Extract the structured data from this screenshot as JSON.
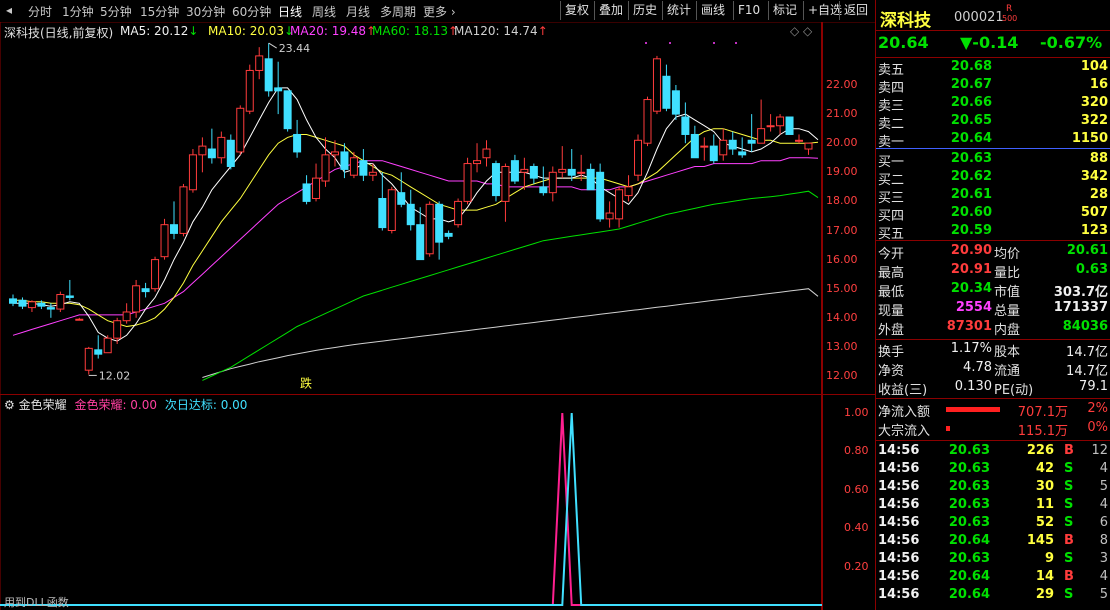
{
  "toolbar": {
    "periods": [
      "分时",
      "1分钟",
      "5分钟",
      "15分钟",
      "30分钟",
      "60分钟",
      "日线",
      "周线",
      "月线",
      "多周期",
      "更多"
    ],
    "active_period": "日线",
    "right_buttons": [
      "复权",
      "叠加",
      "历史",
      "统计",
      "画线",
      "F10",
      "标记",
      "+自选",
      "返回"
    ]
  },
  "chart_header": {
    "title": "深科技(日线,前复权)",
    "ma5": "MA5: 20.12",
    "ma10": "MA10: 20.03",
    "ma20": "MA20: 19.48",
    "ma60": "MA60: 18.13",
    "ma120": "MA120: 14.74",
    "arrows": [
      "↓",
      "↓",
      "↑",
      "↑",
      "↑"
    ]
  },
  "price_axis": [
    "22.00",
    "21.00",
    "20.00",
    "19.00",
    "18.00",
    "17.00",
    "16.00",
    "15.00",
    "14.00",
    "13.00",
    "12.00"
  ],
  "annotations": {
    "high_label": "23.44",
    "low_label": "12.02",
    "marker": "跌"
  },
  "indicator": {
    "name": "金色荣耀",
    "line1": "金色荣耀: 0.00",
    "line2": "次日达标: 0.00",
    "axis": [
      "1.00",
      "0.80",
      "0.60",
      "0.40",
      "0.20"
    ],
    "footer": "用到DLL函数"
  },
  "colors": {
    "up": "#ff3c3c",
    "down": "#40e0ff",
    "ma5": "#ffffff",
    "ma10": "#ffff40",
    "ma20": "#ff40ff",
    "ma60": "#00e000",
    "ma120": "#d0d0d0"
  },
  "chart_data": {
    "type": "candlestick",
    "candles": [
      {
        "o": 14.65,
        "h": 14.8,
        "l": 14.4,
        "c": 14.5
      },
      {
        "o": 14.6,
        "h": 14.7,
        "l": 14.3,
        "c": 14.4
      },
      {
        "o": 14.35,
        "h": 14.6,
        "l": 14.2,
        "c": 14.55
      },
      {
        "o": 14.5,
        "h": 14.6,
        "l": 14.3,
        "c": 14.4
      },
      {
        "o": 14.35,
        "h": 14.5,
        "l": 14.0,
        "c": 14.3
      },
      {
        "o": 14.3,
        "h": 14.9,
        "l": 14.2,
        "c": 14.8
      },
      {
        "o": 14.75,
        "h": 15.3,
        "l": 14.6,
        "c": 14.7
      },
      {
        "o": 13.95,
        "h": 14.0,
        "l": 13.95,
        "c": 13.95
      },
      {
        "o": 12.2,
        "h": 13.0,
        "l": 12.05,
        "c": 12.95
      },
      {
        "o": 12.9,
        "h": 13.4,
        "l": 12.6,
        "c": 12.75
      },
      {
        "o": 12.8,
        "h": 13.4,
        "l": 12.8,
        "c": 13.3
      },
      {
        "o": 13.3,
        "h": 14.0,
        "l": 13.1,
        "c": 13.9
      },
      {
        "o": 13.9,
        "h": 14.5,
        "l": 13.8,
        "c": 14.2
      },
      {
        "o": 14.2,
        "h": 15.3,
        "l": 14.0,
        "c": 15.1
      },
      {
        "o": 15.0,
        "h": 15.2,
        "l": 14.7,
        "c": 14.9
      },
      {
        "o": 15.0,
        "h": 16.1,
        "l": 14.9,
        "c": 16.0
      },
      {
        "o": 16.1,
        "h": 17.4,
        "l": 16.0,
        "c": 17.2
      },
      {
        "o": 17.2,
        "h": 18.0,
        "l": 16.7,
        "c": 16.9
      },
      {
        "o": 16.9,
        "h": 18.6,
        "l": 16.8,
        "c": 18.5
      },
      {
        "o": 18.4,
        "h": 19.8,
        "l": 18.3,
        "c": 19.6
      },
      {
        "o": 19.6,
        "h": 20.2,
        "l": 19.0,
        "c": 19.9
      },
      {
        "o": 19.8,
        "h": 20.5,
        "l": 19.3,
        "c": 19.5
      },
      {
        "o": 19.5,
        "h": 20.4,
        "l": 19.3,
        "c": 20.2
      },
      {
        "o": 20.1,
        "h": 20.3,
        "l": 19.1,
        "c": 19.2
      },
      {
        "o": 19.7,
        "h": 21.3,
        "l": 19.6,
        "c": 21.2
      },
      {
        "o": 21.1,
        "h": 22.7,
        "l": 21.0,
        "c": 22.5
      },
      {
        "o": 22.5,
        "h": 23.3,
        "l": 22.2,
        "c": 23.0
      },
      {
        "o": 22.9,
        "h": 23.44,
        "l": 21.6,
        "c": 21.8
      },
      {
        "o": 21.9,
        "h": 22.8,
        "l": 21.0,
        "c": 21.8
      },
      {
        "o": 21.8,
        "h": 21.8,
        "l": 20.4,
        "c": 20.5
      },
      {
        "o": 20.3,
        "h": 20.8,
        "l": 19.5,
        "c": 19.7
      },
      {
        "o": 18.6,
        "h": 18.9,
        "l": 17.9,
        "c": 18.0
      },
      {
        "o": 18.1,
        "h": 19.3,
        "l": 18.0,
        "c": 18.8
      },
      {
        "o": 18.7,
        "h": 20.2,
        "l": 18.5,
        "c": 19.6
      },
      {
        "o": 19.6,
        "h": 20.1,
        "l": 19.2,
        "c": 19.7
      },
      {
        "o": 19.7,
        "h": 20.0,
        "l": 18.8,
        "c": 19.1
      },
      {
        "o": 18.9,
        "h": 19.7,
        "l": 18.8,
        "c": 19.5
      },
      {
        "o": 19.4,
        "h": 19.8,
        "l": 18.7,
        "c": 18.9
      },
      {
        "o": 18.9,
        "h": 19.3,
        "l": 18.7,
        "c": 19.0
      },
      {
        "o": 18.1,
        "h": 19.0,
        "l": 17.0,
        "c": 17.1
      },
      {
        "o": 17.0,
        "h": 18.5,
        "l": 16.9,
        "c": 18.4
      },
      {
        "o": 18.3,
        "h": 19.0,
        "l": 17.8,
        "c": 17.9
      },
      {
        "o": 17.9,
        "h": 18.4,
        "l": 17.0,
        "c": 17.2
      },
      {
        "o": 17.2,
        "h": 17.8,
        "l": 16.0,
        "c": 16.0
      },
      {
        "o": 16.2,
        "h": 18.0,
        "l": 16.1,
        "c": 17.9
      },
      {
        "o": 17.9,
        "h": 18.0,
        "l": 16.0,
        "c": 16.6
      },
      {
        "o": 16.9,
        "h": 17.0,
        "l": 16.7,
        "c": 16.8
      },
      {
        "o": 17.2,
        "h": 18.1,
        "l": 17.1,
        "c": 18.0
      },
      {
        "o": 18.0,
        "h": 19.5,
        "l": 17.9,
        "c": 19.3
      },
      {
        "o": 19.3,
        "h": 20.0,
        "l": 19.0,
        "c": 19.4
      },
      {
        "o": 19.5,
        "h": 20.1,
        "l": 19.2,
        "c": 19.8
      },
      {
        "o": 19.3,
        "h": 19.4,
        "l": 18.0,
        "c": 18.2
      },
      {
        "o": 18.0,
        "h": 19.3,
        "l": 17.3,
        "c": 19.2
      },
      {
        "o": 19.4,
        "h": 19.6,
        "l": 18.6,
        "c": 18.7
      },
      {
        "o": 19.0,
        "h": 19.5,
        "l": 18.4,
        "c": 19.1
      },
      {
        "o": 19.2,
        "h": 19.3,
        "l": 18.6,
        "c": 18.8
      },
      {
        "o": 18.5,
        "h": 19.2,
        "l": 18.2,
        "c": 18.3
      },
      {
        "o": 18.3,
        "h": 19.2,
        "l": 18.0,
        "c": 19.0
      },
      {
        "o": 19.0,
        "h": 19.9,
        "l": 18.8,
        "c": 19.1
      },
      {
        "o": 19.1,
        "h": 19.8,
        "l": 18.7,
        "c": 18.9
      },
      {
        "o": 19.0,
        "h": 19.6,
        "l": 18.7,
        "c": 19.0
      },
      {
        "o": 19.1,
        "h": 19.3,
        "l": 18.4,
        "c": 18.4
      },
      {
        "o": 19.0,
        "h": 19.3,
        "l": 17.3,
        "c": 17.4
      },
      {
        "o": 17.4,
        "h": 18.0,
        "l": 17.1,
        "c": 17.6
      },
      {
        "o": 17.4,
        "h": 18.5,
        "l": 17.1,
        "c": 18.4
      },
      {
        "o": 18.2,
        "h": 18.9,
        "l": 18.0,
        "c": 18.5
      },
      {
        "o": 18.9,
        "h": 20.3,
        "l": 18.7,
        "c": 20.1
      },
      {
        "o": 20.0,
        "h": 21.6,
        "l": 19.9,
        "c": 21.5
      },
      {
        "o": 21.1,
        "h": 23.0,
        "l": 21.0,
        "c": 22.9
      },
      {
        "o": 22.3,
        "h": 22.7,
        "l": 21.1,
        "c": 21.2
      },
      {
        "o": 21.8,
        "h": 22.0,
        "l": 20.8,
        "c": 21.0
      },
      {
        "o": 20.9,
        "h": 21.4,
        "l": 20.0,
        "c": 20.3
      },
      {
        "o": 20.3,
        "h": 20.6,
        "l": 19.5,
        "c": 19.5
      },
      {
        "o": 19.9,
        "h": 20.2,
        "l": 19.4,
        "c": 19.9
      },
      {
        "o": 19.9,
        "h": 20.3,
        "l": 19.3,
        "c": 19.4
      },
      {
        "o": 19.6,
        "h": 20.5,
        "l": 19.4,
        "c": 20.1
      },
      {
        "o": 20.1,
        "h": 20.4,
        "l": 19.6,
        "c": 19.8
      },
      {
        "o": 19.7,
        "h": 20.2,
        "l": 19.5,
        "c": 19.6
      },
      {
        "o": 20.1,
        "h": 21.0,
        "l": 19.7,
        "c": 20.0
      },
      {
        "o": 20.0,
        "h": 21.5,
        "l": 20.0,
        "c": 20.5
      },
      {
        "o": 20.6,
        "h": 21.0,
        "l": 20.4,
        "c": 20.6
      },
      {
        "o": 20.6,
        "h": 21.0,
        "l": 20.3,
        "c": 20.9
      },
      {
        "o": 20.9,
        "h": 20.9,
        "l": 20.3,
        "c": 20.3
      },
      {
        "o": 20.1,
        "h": 20.3,
        "l": 20.0,
        "c": 20.1
      },
      {
        "o": 19.8,
        "h": 20.0,
        "l": 19.6,
        "c": 20.0
      }
    ],
    "ma5": [
      14.5,
      14.5,
      14.5,
      14.45,
      14.4,
      14.45,
      14.55,
      14.5,
      14.05,
      13.5,
      13.3,
      13.2,
      13.4,
      13.8,
      14.3,
      14.7,
      15.3,
      16.0,
      16.6,
      17.3,
      17.8,
      18.4,
      18.8,
      19.2,
      19.6,
      20.2,
      20.8,
      21.4,
      21.9,
      21.9,
      21.5,
      20.8,
      20.2,
      19.8,
      19.5,
      19.0,
      19.1,
      19.3,
      19.3,
      18.9,
      18.6,
      18.2,
      17.8,
      17.6,
      17.4,
      17.4,
      17.3,
      17.4,
      17.8,
      18.3,
      18.7,
      19.0,
      19.0,
      19.0,
      19.0,
      18.9,
      18.8,
      18.8,
      18.8,
      18.8,
      18.9,
      18.8,
      18.5,
      18.3,
      18.1,
      17.9,
      18.3,
      19.0,
      19.8,
      20.5,
      20.9,
      21.0,
      20.8,
      20.6,
      20.4,
      20.0,
      19.9,
      19.8,
      19.7,
      19.8,
      20.0,
      20.3,
      20.5,
      20.5,
      20.4,
      20.12
    ],
    "ma10": [
      14.6,
      14.6,
      14.55,
      14.55,
      14.5,
      14.5,
      14.5,
      14.45,
      14.3,
      14.1,
      13.9,
      13.8,
      13.7,
      13.75,
      13.85,
      14.0,
      14.3,
      14.7,
      15.2,
      15.8,
      16.3,
      16.8,
      17.3,
      17.7,
      18.1,
      18.6,
      19.1,
      19.6,
      20.0,
      20.2,
      20.3,
      20.3,
      20.2,
      20.1,
      20.0,
      19.9,
      19.6,
      19.4,
      19.2,
      19.0,
      18.9,
      18.7,
      18.5,
      18.3,
      18.1,
      17.9,
      17.8,
      17.7,
      17.7,
      17.7,
      17.8,
      17.9,
      18.1,
      18.3,
      18.5,
      18.6,
      18.7,
      18.8,
      18.8,
      18.8,
      18.8,
      18.8,
      18.8,
      18.7,
      18.6,
      18.5,
      18.6,
      18.8,
      19.0,
      19.3,
      19.6,
      19.9,
      20.2,
      20.4,
      20.5,
      20.5,
      20.4,
      20.3,
      20.2,
      20.1,
      20.1,
      20.0,
      20.0,
      20.0,
      20.0,
      20.03
    ],
    "ma20": [
      13.4,
      13.5,
      13.6,
      13.7,
      13.8,
      13.9,
      14.0,
      14.1,
      14.1,
      14.1,
      14.1,
      14.1,
      14.1,
      14.2,
      14.3,
      14.4,
      14.5,
      14.7,
      14.9,
      15.2,
      15.5,
      15.8,
      16.1,
      16.4,
      16.7,
      17.0,
      17.3,
      17.6,
      17.9,
      18.1,
      18.3,
      18.5,
      18.7,
      18.9,
      19.1,
      19.2,
      19.3,
      19.4,
      19.4,
      19.4,
      19.3,
      19.2,
      19.1,
      19.0,
      18.9,
      18.8,
      18.7,
      18.7,
      18.7,
      18.7,
      18.6,
      18.6,
      18.5,
      18.5,
      18.5,
      18.5,
      18.5,
      18.5,
      18.5,
      18.5,
      18.4,
      18.4,
      18.4,
      18.4,
      18.5,
      18.5,
      18.6,
      18.7,
      18.8,
      18.9,
      19.0,
      19.1,
      19.2,
      19.2,
      19.3,
      19.3,
      19.3,
      19.3,
      19.3,
      19.4,
      19.4,
      19.4,
      19.5,
      19.5,
      19.5,
      19.48
    ],
    "ma60": [
      null,
      null,
      null,
      null,
      null,
      null,
      null,
      null,
      null,
      null,
      null,
      null,
      null,
      null,
      null,
      null,
      null,
      null,
      null,
      null,
      11.85,
      12.0,
      12.15,
      12.3,
      12.5,
      12.7,
      12.9,
      13.1,
      13.3,
      13.5,
      13.7,
      13.85,
      14.0,
      14.15,
      14.3,
      14.45,
      14.6,
      14.75,
      14.85,
      14.95,
      15.05,
      15.15,
      15.25,
      15.35,
      15.45,
      15.55,
      15.65,
      15.75,
      15.85,
      15.95,
      16.05,
      16.15,
      16.25,
      16.35,
      16.45,
      16.55,
      16.65,
      16.7,
      16.75,
      16.8,
      16.85,
      16.9,
      16.95,
      17.0,
      17.05,
      17.15,
      17.25,
      17.35,
      17.45,
      17.55,
      17.62,
      17.69,
      17.76,
      17.83,
      17.9,
      17.95,
      18.0,
      18.05,
      18.1,
      18.13,
      18.16,
      18.2,
      18.25,
      18.3,
      18.35,
      18.13
    ],
    "ma120": [
      null,
      null,
      null,
      null,
      null,
      null,
      null,
      null,
      null,
      null,
      null,
      null,
      null,
      null,
      null,
      null,
      null,
      null,
      null,
      null,
      11.95,
      12.05,
      12.15,
      12.25,
      12.33,
      12.41,
      12.49,
      12.56,
      12.63,
      12.7,
      12.76,
      12.82,
      12.88,
      12.93,
      12.98,
      13.03,
      13.08,
      13.12,
      13.16,
      13.2,
      13.24,
      13.28,
      13.32,
      13.36,
      13.4,
      13.44,
      13.48,
      13.52,
      13.56,
      13.6,
      13.64,
      13.68,
      13.72,
      13.76,
      13.8,
      13.84,
      13.88,
      13.92,
      13.96,
      14.0,
      14.04,
      14.08,
      14.12,
      14.16,
      14.2,
      14.24,
      14.28,
      14.32,
      14.36,
      14.4,
      14.44,
      14.48,
      14.52,
      14.56,
      14.6,
      14.64,
      14.68,
      14.72,
      14.76,
      14.8,
      14.84,
      14.88,
      14.92,
      14.96,
      15.0,
      14.74
    ],
    "indicator_spikes": [
      {
        "series": "金色荣耀",
        "index": 58,
        "value": 1.0
      },
      {
        "series": "次日达标",
        "index": 59,
        "value": 1.0
      }
    ]
  },
  "quote": {
    "name": "深科技",
    "code": "000021",
    "badge_top": "R",
    "badge_bottom": "500",
    "price": "20.64",
    "change": "▼-0.14",
    "change_pct": "-0.67%",
    "sell": [
      {
        "label": "卖五",
        "price": "20.68",
        "vol": "104"
      },
      {
        "label": "卖四",
        "price": "20.67",
        "vol": "16"
      },
      {
        "label": "卖三",
        "price": "20.66",
        "vol": "320"
      },
      {
        "label": "卖二",
        "price": "20.65",
        "vol": "322"
      },
      {
        "label": "卖一",
        "price": "20.64",
        "vol": "1150"
      }
    ],
    "buy": [
      {
        "label": "买一",
        "price": "20.63",
        "vol": "88"
      },
      {
        "label": "买二",
        "price": "20.62",
        "vol": "342"
      },
      {
        "label": "买三",
        "price": "20.61",
        "vol": "28"
      },
      {
        "label": "买四",
        "price": "20.60",
        "vol": "507"
      },
      {
        "label": "买五",
        "price": "20.59",
        "vol": "123"
      }
    ],
    "stats": [
      {
        "l1": "今开",
        "v1": "20.90",
        "c1": "red",
        "l2": "均价",
        "v2": "20.61",
        "c2": "green"
      },
      {
        "l1": "最高",
        "v1": "20.91",
        "c1": "red",
        "l2": "量比",
        "v2": "0.63",
        "c2": "green"
      },
      {
        "l1": "最低",
        "v1": "20.34",
        "c1": "green",
        "l2": "市值",
        "v2": "303.7亿",
        "c2": "white"
      },
      {
        "l1": "现量",
        "v1": "2554",
        "c1": "magenta",
        "l2": "总量",
        "v2": "171337",
        "c2": "white"
      },
      {
        "l1": "外盘",
        "v1": "87301",
        "c1": "red",
        "l2": "内盘",
        "v2": "84036",
        "c2": "green"
      }
    ],
    "stats2": [
      {
        "l1": "换手",
        "v1": "1.17%",
        "l2": "股本",
        "v2": "14.7亿"
      },
      {
        "l1": "净资",
        "v1": "4.78",
        "l2": "流通",
        "v2": "14.7亿"
      },
      {
        "l1": "收益(三)",
        "v1": "0.130",
        "l2": "PE(动)",
        "v2": "79.1"
      }
    ],
    "flow": [
      {
        "label": "净流入额",
        "value": "707.1万",
        "pct": "2%",
        "bar": 0.9
      },
      {
        "label": "大宗流入",
        "value": "115.1万",
        "pct": "0%",
        "bar": 0.07
      }
    ],
    "ticks": [
      {
        "t": "14:56",
        "p": "20.63",
        "v": "226",
        "s": "B",
        "n": "12"
      },
      {
        "t": "14:56",
        "p": "20.63",
        "v": "42",
        "s": "S",
        "n": "4"
      },
      {
        "t": "14:56",
        "p": "20.63",
        "v": "30",
        "s": "S",
        "n": "5"
      },
      {
        "t": "14:56",
        "p": "20.63",
        "v": "11",
        "s": "S",
        "n": "4"
      },
      {
        "t": "14:56",
        "p": "20.63",
        "v": "52",
        "s": "S",
        "n": "6"
      },
      {
        "t": "14:56",
        "p": "20.64",
        "v": "145",
        "s": "B",
        "n": "8"
      },
      {
        "t": "14:56",
        "p": "20.63",
        "v": "9",
        "s": "S",
        "n": "3"
      },
      {
        "t": "14:56",
        "p": "20.64",
        "v": "14",
        "s": "B",
        "n": "4"
      },
      {
        "t": "14:56",
        "p": "20.64",
        "v": "29",
        "s": "S",
        "n": "5"
      }
    ]
  }
}
